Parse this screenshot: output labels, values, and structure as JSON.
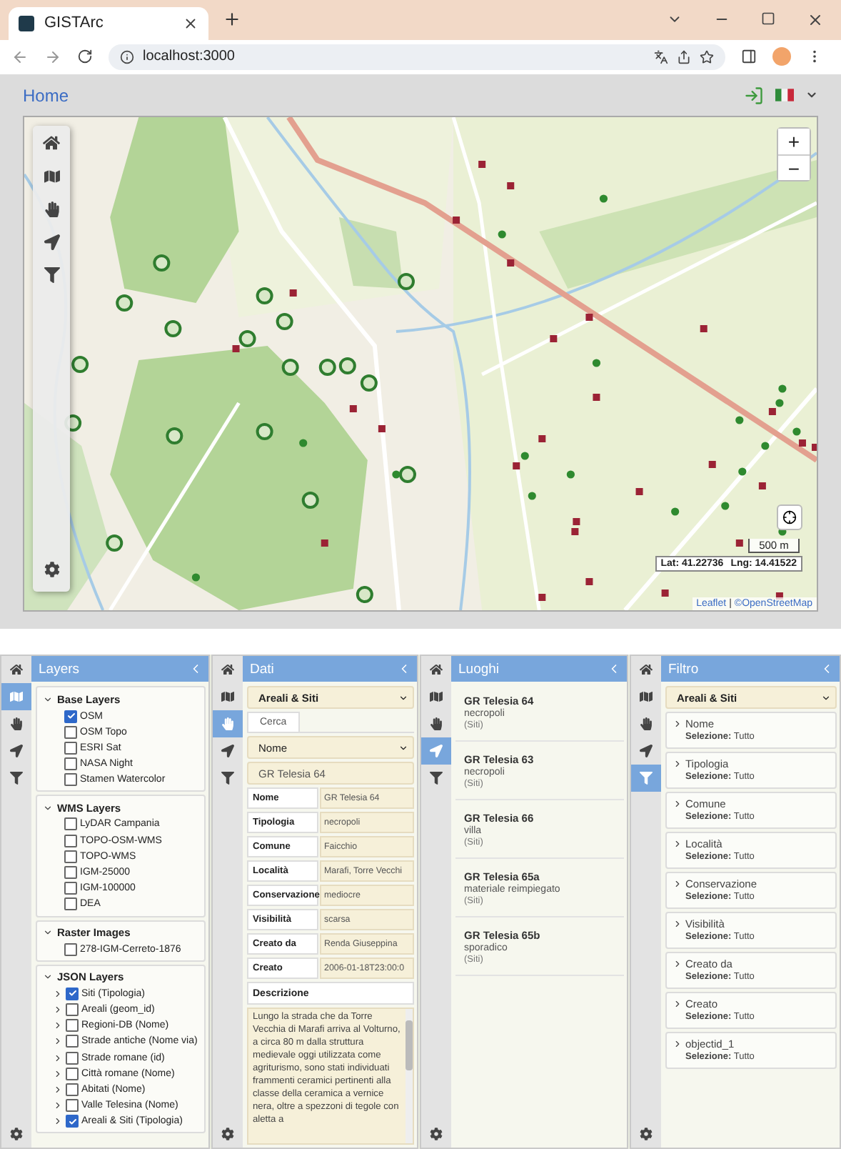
{
  "browser": {
    "tab_title": "GISTArc",
    "url": "localhost:3000"
  },
  "header": {
    "home_link": "Home"
  },
  "map": {
    "zoom_in": "+",
    "zoom_out": "−",
    "scale": "500 m",
    "latitude": "Lat: 41.22736",
    "longitude": "Lng: 14.41522",
    "attribution_link": "Leaflet",
    "attribution_separator": "|",
    "attribution_source": "©OpenStreetMap"
  },
  "panels": [
    {
      "kind": "layers",
      "title": "Layers",
      "rail": [
        {
          "selected": false
        },
        {
          "selected": true
        },
        {
          "selected": false
        },
        {
          "selected": false
        },
        {
          "selected": false
        }
      ],
      "groups": [
        {
          "title": "Base Layers",
          "expanded": true,
          "items": [
            {
              "label": "OSM",
              "checked": true,
              "expandable": false
            },
            {
              "label": "OSM Topo",
              "checked": false,
              "expandable": false
            },
            {
              "label": "ESRI Sat",
              "checked": false,
              "expandable": false
            },
            {
              "label": "NASA Night",
              "checked": false,
              "expandable": false
            },
            {
              "label": "Stamen Watercolor",
              "checked": false,
              "expandable": false
            }
          ]
        },
        {
          "title": "WMS Layers",
          "expanded": true,
          "items": [
            {
              "label": "LyDAR Campania",
              "checked": false,
              "expandable": false
            },
            {
              "label": "TOPO-OSM-WMS",
              "checked": false,
              "expandable": false
            },
            {
              "label": "TOPO-WMS",
              "checked": false,
              "expandable": false
            },
            {
              "label": "IGM-25000",
              "checked": false,
              "expandable": false
            },
            {
              "label": "IGM-100000",
              "checked": false,
              "expandable": false
            },
            {
              "label": "DEA",
              "checked": false,
              "expandable": false
            }
          ]
        },
        {
          "title": "Raster Images",
          "expanded": true,
          "items": [
            {
              "label": "278-IGM-Cerreto-1876",
              "checked": false,
              "expandable": false
            }
          ]
        },
        {
          "title": "JSON Layers",
          "expanded": true,
          "items": [
            {
              "label": "Siti (Tipologia)",
              "checked": true,
              "expandable": true
            },
            {
              "label": "Areali (geom_id)",
              "checked": false,
              "expandable": true
            },
            {
              "label": "Regioni-DB (Nome)",
              "checked": false,
              "expandable": true
            },
            {
              "label": "Strade antiche (Nome via)",
              "checked": false,
              "expandable": true
            },
            {
              "label": "Strade romane (id)",
              "checked": false,
              "expandable": true
            },
            {
              "label": "Città romane (Nome)",
              "checked": false,
              "expandable": true
            },
            {
              "label": "Abitati (Nome)",
              "checked": false,
              "expandable": true
            },
            {
              "label": "Valle Telesina (Nome)",
              "checked": false,
              "expandable": true
            },
            {
              "label": "Areali & Siti (Tipologia)",
              "checked": true,
              "expandable": true
            }
          ]
        }
      ]
    },
    {
      "kind": "data",
      "title": "Dati",
      "rail": [
        {
          "selected": false
        },
        {
          "selected": false
        },
        {
          "selected": true
        },
        {
          "selected": false
        },
        {
          "selected": false
        }
      ],
      "dataset": "Areali & Siti",
      "tabs": [
        {
          "label": "Cerca",
          "selected": true
        }
      ],
      "search_field": "Nome",
      "search_value": "GR Telesia 64",
      "fields": [
        {
          "label": "Nome",
          "value": "GR Telesia 64"
        },
        {
          "label": "Tipologia",
          "value": "necropoli"
        },
        {
          "label": "Comune",
          "value": "Faicchio"
        },
        {
          "label": "Località",
          "value": "Marafi, Torre Vecchi"
        },
        {
          "label": "Conservazione",
          "value": "mediocre"
        },
        {
          "label": "Visibilità",
          "value": "scarsa"
        },
        {
          "label": "Creato da",
          "value": "Renda Giuseppina"
        },
        {
          "label": "Creato",
          "value": "2006-01-18T23:00:0"
        }
      ],
      "description_label": "Descrizione",
      "description": "Lungo la strada che da Torre Vecchia di Marafi arriva al Volturno, a circa 80 m dalla struttura medievale oggi utilizzata come agriturismo, sono stati individuati frammenti ceramici pertinenti alla classe della ceramica a vernice nera, oltre a spezzoni di tegole con aletta a"
    },
    {
      "kind": "places",
      "title": "Luoghi",
      "rail": [
        {
          "selected": false
        },
        {
          "selected": false
        },
        {
          "selected": false
        },
        {
          "selected": true
        },
        {
          "selected": false
        }
      ],
      "items": [
        {
          "name": "GR Telesia 64",
          "type": "necropoli",
          "layer": "(Siti)"
        },
        {
          "name": "GR Telesia 63",
          "type": "necropoli",
          "layer": "(Siti)"
        },
        {
          "name": "GR Telesia 66",
          "type": "villa",
          "layer": "(Siti)"
        },
        {
          "name": "GR Telesia 65a",
          "type": "materiale reimpiegato",
          "layer": "(Siti)"
        },
        {
          "name": "GR Telesia 65b",
          "type": "sporadico",
          "layer": "(Siti)"
        }
      ]
    },
    {
      "kind": "filter",
      "title": "Filtro",
      "rail": [
        {
          "selected": false
        },
        {
          "selected": false
        },
        {
          "selected": false
        },
        {
          "selected": false
        },
        {
          "selected": true
        }
      ],
      "dataset": "Areali & Siti",
      "items": [
        {
          "name": "Nome",
          "selection": "**Selezione:** Tutto"
        },
        {
          "name": "Tipologia",
          "selection": "**Selezione:** Tutto"
        },
        {
          "name": "Comune",
          "selection": "**Selezione:** Tutto"
        },
        {
          "name": "Località",
          "selection": "**Selezione:** Tutto"
        },
        {
          "name": "Conservazione",
          "selection": "**Selezione:** Tutto"
        },
        {
          "name": "Visibilità",
          "selection": "**Selezione:** Tutto"
        },
        {
          "name": "Creato da",
          "selection": "**Selezione:** Tutto"
        },
        {
          "name": "Creato",
          "selection": "**Selezione:** Tutto"
        },
        {
          "name": "objectid_1",
          "selection": "**Selezione:** Tutto"
        }
      ]
    }
  ]
}
